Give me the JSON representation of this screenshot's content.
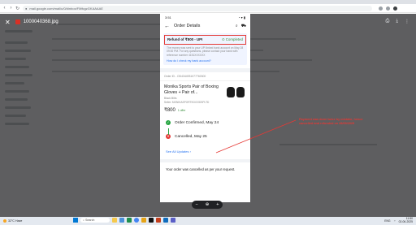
{
  "browser": {
    "url": "mail.google.com/mail/u/0/#inbox/FMfcgzGKAAAAE"
  },
  "viewer": {
    "file_name": "1000040368.jpg"
  },
  "phone": {
    "status_time": "3:51",
    "status_right": "◔ ▾ ▮",
    "header_title": "Order Details",
    "refund": {
      "amount_text": "Refund of ₹800 - UPI",
      "status": "Completed",
      "description": "The money was sent to your UPI linked bank account on May 28 09:00 PM. For any questions, please contact your bank with reference number",
      "reference": "4151XXXXXX",
      "link_text": "How do I check my bank account?"
    },
    "order_id": "Order ID - OD4344931077760300",
    "product": {
      "name": "Monika Sports Pair of Boxing Gloves + Pair of...",
      "size": "Black Mitts",
      "seller": "Seller: MONIKASPORTSGOODSPLTD",
      "price": "₹800",
      "offer": "1 offer"
    },
    "tracking": [
      {
        "label": "Order Confirmed, May 24",
        "icon": "check-icon"
      },
      {
        "label": "Cancelled, May 25",
        "icon": "cross-icon"
      }
    ],
    "see_updates": "See All Updates ›",
    "cancel_message": "Your order was cancelled as per your request."
  },
  "annotation": {
    "text": "Payment was done twice by mistake, hence cancelled and refunded on 28/05/2025"
  },
  "zoom": {
    "minus": "−",
    "zoom_icon": "⊕",
    "plus": "+"
  },
  "taskbar": {
    "weather_temp": "32°C",
    "weather_text": "Haze",
    "search_placeholder": "Search",
    "time": "11:50",
    "date": "02-06-2025",
    "lang": "ENG"
  },
  "colors": {
    "annotation": "#e53935",
    "refund_border": "#e53935",
    "completed": "#388e3c",
    "link": "#2874f0"
  }
}
